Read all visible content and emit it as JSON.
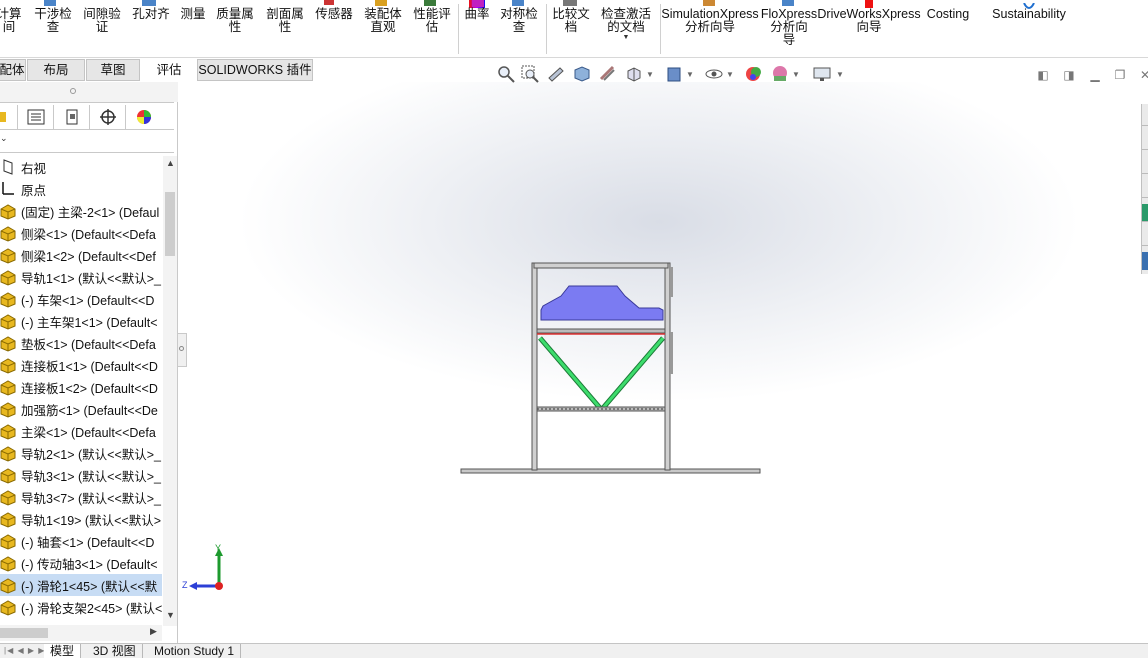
{
  "ribbon": {
    "buttons": [
      {
        "name": "calculate-button",
        "label": "计算\n间"
      },
      {
        "name": "interference-check-button",
        "label": "干涉检\n查"
      },
      {
        "name": "clearance-verify-button",
        "label": "间隙验\n证"
      },
      {
        "name": "hole-align-button",
        "label": "孔对齐"
      },
      {
        "name": "measure-button",
        "label": "测量"
      },
      {
        "name": "mass-properties-button",
        "label": "质量属\n性"
      },
      {
        "name": "section-properties-button",
        "label": "剖面属\n性"
      },
      {
        "name": "sensor-button",
        "label": "传感器"
      },
      {
        "name": "assembly-visualization-button",
        "label": "装配体\n直观"
      },
      {
        "name": "performance-eval-button",
        "label": "性能评\n估"
      },
      {
        "name": "curvature-button",
        "label": "曲率"
      },
      {
        "name": "symmetry-check-button",
        "label": "对称检\n查"
      },
      {
        "name": "compare-documents-button",
        "label": "比较文\n档"
      },
      {
        "name": "check-active-doc-button",
        "label": "检查激活\n的文档"
      },
      {
        "name": "simulationxpress-button",
        "label": "SimulationXpress\n分析向导"
      },
      {
        "name": "floxpress-button",
        "label": "FloXpress\n分析向\n导"
      },
      {
        "name": "driveworksxpress-button",
        "label": "DriveWorksXpress\n向导"
      },
      {
        "name": "costing-button",
        "label": "Costing"
      },
      {
        "name": "sustainability-button",
        "label": "Sustainability"
      }
    ]
  },
  "command_tabs": [
    "配体",
    "布局",
    "草图",
    "评估",
    "SOLIDWORKS 插件"
  ],
  "tree": {
    "items": [
      {
        "icon": "plane-icon",
        "label": "右视"
      },
      {
        "icon": "origin-icon",
        "label": "原点"
      },
      {
        "icon": "part-icon",
        "label": "(固定) 主梁-2<1> (Defaul"
      },
      {
        "icon": "part-icon",
        "label": "侧梁<1> (Default<<Defa"
      },
      {
        "icon": "part-icon",
        "label": "侧梁1<2> (Default<<Def"
      },
      {
        "icon": "part-icon",
        "label": "导轨1<1> (默认<<默认>_"
      },
      {
        "icon": "part-icon",
        "label": "(-) 车架<1> (Default<<D"
      },
      {
        "icon": "part-icon",
        "label": "(-) 主车架1<1> (Default<"
      },
      {
        "icon": "part-icon",
        "label": "垫板<1> (Default<<Defa"
      },
      {
        "icon": "part-icon",
        "label": "连接板1<1> (Default<<D"
      },
      {
        "icon": "part-icon",
        "label": "连接板1<2> (Default<<D"
      },
      {
        "icon": "part-icon",
        "label": "加强筋<1> (Default<<De"
      },
      {
        "icon": "part-icon",
        "label": "主梁<1> (Default<<Defa"
      },
      {
        "icon": "part-icon",
        "label": "导轨2<1> (默认<<默认>_"
      },
      {
        "icon": "part-icon",
        "label": "导轨3<1> (默认<<默认>_"
      },
      {
        "icon": "part-icon",
        "label": "导轨3<7> (默认<<默认>_"
      },
      {
        "icon": "part-icon",
        "label": "导轨1<19> (默认<<默认>"
      },
      {
        "icon": "part-icon",
        "label": "(-) 轴套<1> (Default<<D"
      },
      {
        "icon": "part-icon",
        "label": "(-) 传动轴3<1> (Default<"
      },
      {
        "icon": "part-icon",
        "label": "(-) 滑轮1<45> (默认<<默",
        "selected": true
      },
      {
        "icon": "part-icon",
        "label": "(-) 滑轮支架2<45> (默认<"
      }
    ]
  },
  "triad": {
    "y": "Y",
    "z": "Z"
  },
  "bottom_tabs": [
    "模型",
    "3D 视图",
    "Motion Study 1"
  ],
  "colors": {
    "accent_selected": "#c7dcf4",
    "part_icon": "#e8b820",
    "frame": "#8a8a8a",
    "body": "#7b7bf2",
    "brace": "#22c55e"
  }
}
